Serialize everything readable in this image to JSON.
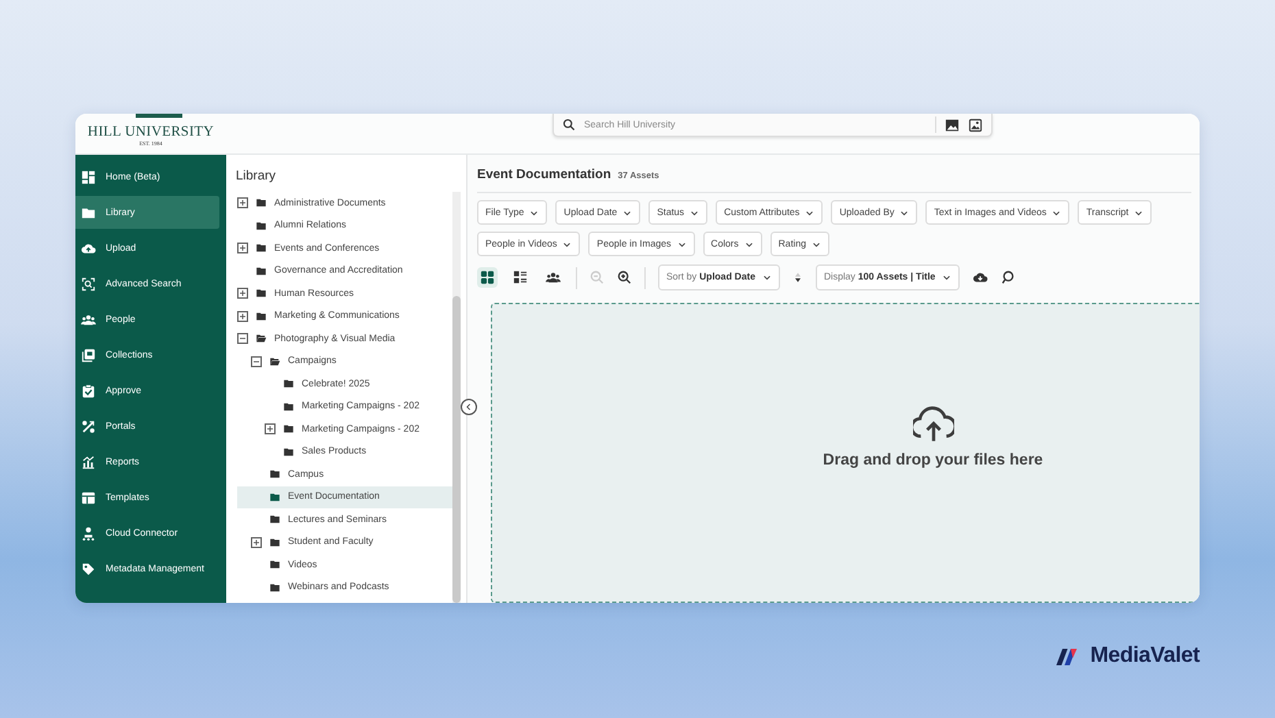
{
  "header": {
    "logo": {
      "name": "HILL UNIVERSITY",
      "tagline": "EST. 1984"
    },
    "search": {
      "placeholder": "Search Hill University"
    }
  },
  "sidebar": {
    "items": [
      {
        "label": "Home (Beta)",
        "selected": false
      },
      {
        "label": "Library",
        "selected": true
      },
      {
        "label": "Upload",
        "selected": false
      },
      {
        "label": "Advanced Search",
        "selected": false
      },
      {
        "label": "People",
        "selected": false
      },
      {
        "label": "Collections",
        "selected": false
      },
      {
        "label": "Approve",
        "selected": false
      },
      {
        "label": "Portals",
        "selected": false
      },
      {
        "label": "Reports",
        "selected": false
      },
      {
        "label": "Templates",
        "selected": false
      },
      {
        "label": "Cloud Connector",
        "selected": false
      },
      {
        "label": "Metadata Management",
        "selected": false
      }
    ]
  },
  "library": {
    "title": "Library",
    "tree": [
      {
        "label": "Administrative Documents",
        "expanded": false,
        "selected": false
      },
      {
        "label": "Alumni Relations",
        "selected": false
      },
      {
        "label": "Events and Conferences",
        "expanded": false,
        "selected": false
      },
      {
        "label": "Governance and Accreditation",
        "selected": false
      },
      {
        "label": "Human Resources",
        "expanded": false,
        "selected": false
      },
      {
        "label": "Marketing & Communications",
        "expanded": false,
        "selected": false
      },
      {
        "label": "Photography & Visual Media",
        "expanded": true,
        "selected": false,
        "children": [
          {
            "label": "Campaigns",
            "expanded": true,
            "selected": false,
            "children": [
              {
                "label": "Celebrate! 2025",
                "selected": false
              },
              {
                "label": "Marketing Campaigns - 202",
                "selected": false
              },
              {
                "label": "Marketing Campaigns - 202",
                "expanded": false,
                "selected": false
              },
              {
                "label": "Sales Products",
                "selected": false
              }
            ]
          },
          {
            "label": "Campus",
            "selected": false
          },
          {
            "label": "Event Documentation",
            "selected": true
          },
          {
            "label": "Lectures and Seminars",
            "selected": false
          },
          {
            "label": "Student and Faculty",
            "expanded": false,
            "selected": false
          },
          {
            "label": "Videos",
            "selected": false
          },
          {
            "label": "Webinars and Podcasts",
            "selected": false
          }
        ]
      }
    ]
  },
  "content": {
    "title": "Event Documentation",
    "count": "37 Assets",
    "filters": [
      [
        "File Type",
        "Upload Date",
        "Status",
        "Custom Attributes",
        "Uploaded By",
        "Text in Images and Videos",
        "Transcript"
      ],
      [
        "People in Videos",
        "People in Images",
        "Colors",
        "Rating"
      ]
    ],
    "view_buttons": [
      {
        "selected": true
      },
      {
        "selected": false
      },
      {
        "selected": false
      }
    ],
    "zoom_buttons": [
      {
        "disabled": true
      },
      {
        "disabled": false
      }
    ],
    "sort": "Sort by **Upload Date**",
    "display": "Display **100 Assets | Title**",
    "dropzone": {
      "text": "Drag and drop your files here"
    }
  },
  "brand": {
    "name": "MediaValet"
  }
}
